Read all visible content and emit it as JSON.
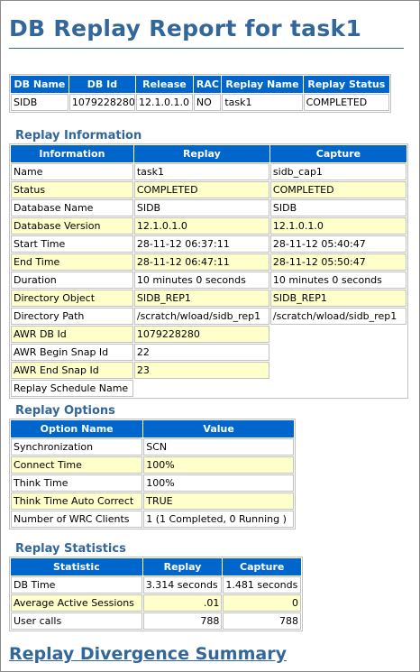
{
  "page": {
    "title": "DB Replay Report for task1"
  },
  "summary": {
    "headers": [
      "DB Name",
      "DB Id",
      "Release",
      "RAC",
      "Replay Name",
      "Replay Status"
    ],
    "rows": [
      [
        "SIDB",
        "1079228280",
        "12.1.0.1.0",
        "NO",
        "task1",
        "COMPLETED"
      ]
    ]
  },
  "replay_information": {
    "heading": "Replay Information",
    "headers": [
      "Information",
      "Replay",
      "Capture"
    ],
    "rows": [
      [
        "Name",
        "task1",
        "sidb_cap1"
      ],
      [
        "Status",
        "COMPLETED",
        "COMPLETED"
      ],
      [
        "Database Name",
        "SIDB",
        "SIDB"
      ],
      [
        "Database Version",
        "12.1.0.1.0",
        "12.1.0.1.0"
      ],
      [
        "Start Time",
        "28-11-12 06:37:11",
        "28-11-12 05:40:47"
      ],
      [
        "End Time",
        "28-11-12 06:47:11",
        "28-11-12 05:50:47"
      ],
      [
        "Duration",
        "10 minutes 0 seconds",
        "10 minutes 0 seconds"
      ],
      [
        "Directory Object",
        "SIDB_REP1",
        "SIDB_REP1"
      ],
      [
        "Directory Path",
        "/scratch/wload/sidb_rep1",
        "/scratch/wload/sidb_rep1"
      ],
      [
        "AWR DB Id",
        "1079228280",
        ""
      ],
      [
        "AWR Begin Snap Id",
        "22",
        ""
      ],
      [
        "AWR End Snap Id",
        "23",
        ""
      ],
      [
        "Replay Schedule Name",
        "",
        ""
      ]
    ]
  },
  "replay_options": {
    "heading": "Replay Options",
    "headers": [
      "Option Name",
      "Value"
    ],
    "rows": [
      [
        "Synchronization",
        "SCN"
      ],
      [
        "Connect Time",
        "100%"
      ],
      [
        "Think Time",
        "100%"
      ],
      [
        "Think Time Auto Correct",
        "TRUE"
      ],
      [
        "Number of WRC Clients",
        "1 (1 Completed, 0 Running )"
      ]
    ]
  },
  "replay_statistics": {
    "heading": "Replay Statistics",
    "headers": [
      "Statistic",
      "Replay",
      "Capture"
    ],
    "rows": [
      [
        "DB Time",
        "3.314 seconds",
        "1.481 seconds"
      ],
      [
        "Average Active Sessions",
        ".01",
        "0"
      ],
      [
        "User calls",
        "788",
        "788"
      ]
    ]
  },
  "divergence": {
    "heading": "Replay Divergence Summary"
  }
}
